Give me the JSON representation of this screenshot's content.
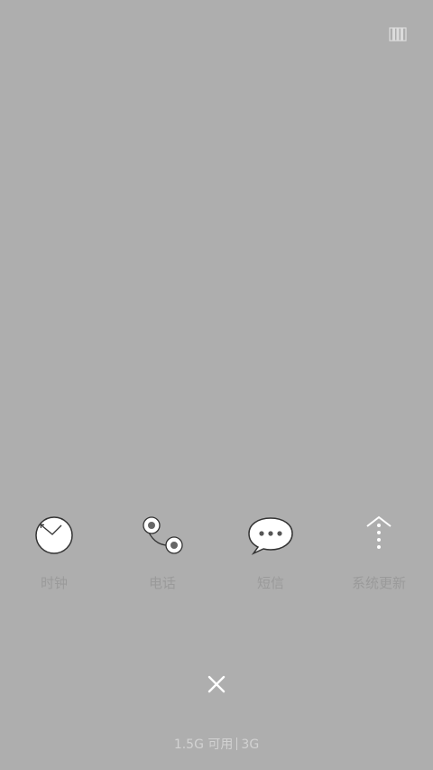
{
  "top_icon": "recents-switch-icon",
  "apps": [
    {
      "label": "时钟",
      "icon": "clock-icon"
    },
    {
      "label": "电话",
      "icon": "phone-icon"
    },
    {
      "label": "短信",
      "icon": "message-icon"
    },
    {
      "label": "系统更新",
      "icon": "update-icon"
    }
  ],
  "close_icon": "close-icon",
  "storage": {
    "available": "1.5G 可用",
    "total": "3G"
  }
}
